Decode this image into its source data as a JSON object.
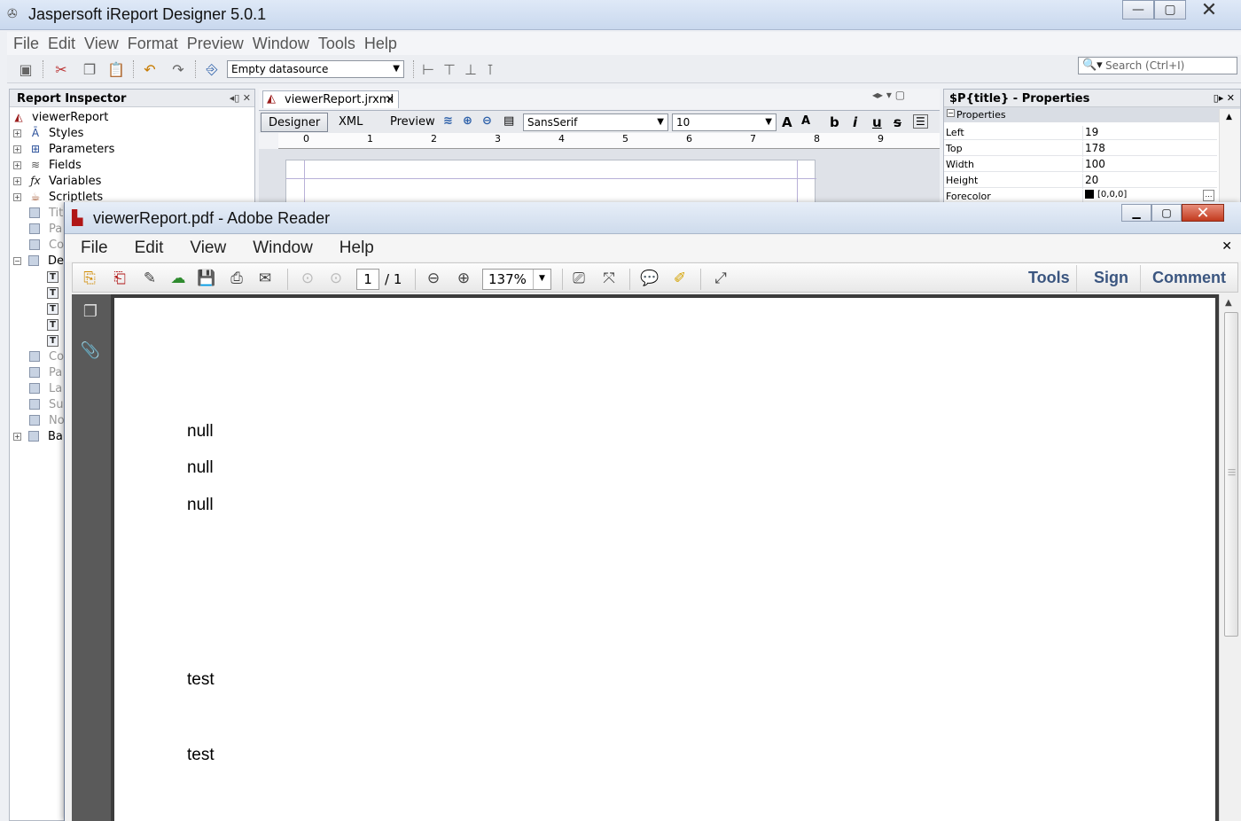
{
  "ireport": {
    "title": "Jaspersoft iReport Designer 5.0.1",
    "menu": [
      "File",
      "Edit",
      "View",
      "Format",
      "Preview",
      "Window",
      "Tools",
      "Help"
    ],
    "datasource": "Empty datasource",
    "search_placeholder": "Search (Ctrl+I)",
    "inspector": {
      "title": "Report Inspector",
      "root": "viewerReport",
      "items": [
        "Styles",
        "Parameters",
        "Fields",
        "Variables",
        "Scriptlets"
      ],
      "dim_items": [
        "Tit",
        "Pa",
        "Co",
        "De",
        "Co",
        "Pa",
        "La",
        "Su",
        "No",
        "Ba"
      ]
    },
    "designer": {
      "tab": "viewerReport.jrxml",
      "modes": [
        "Designer",
        "XML",
        "Preview"
      ],
      "font": "SansSerif",
      "font_size": "10",
      "ruler": [
        "0",
        "1",
        "2",
        "3",
        "4",
        "5",
        "6",
        "7",
        "8",
        "9"
      ]
    },
    "properties": {
      "title": "$P{title} - Properties",
      "category": "Properties",
      "rows": [
        {
          "key": "Left",
          "value": "19"
        },
        {
          "key": "Top",
          "value": "178"
        },
        {
          "key": "Width",
          "value": "100"
        },
        {
          "key": "Height",
          "value": "20"
        },
        {
          "key": "Forecolor",
          "value": "[0,0,0]"
        }
      ]
    }
  },
  "reader": {
    "title": "viewerReport.pdf - Adobe Reader",
    "menu": [
      "File",
      "Edit",
      "View",
      "Window",
      "Help"
    ],
    "page_current": "1",
    "page_total": "/ 1",
    "zoom": "137%",
    "links": [
      "Tools",
      "Sign",
      "Comment"
    ],
    "page_lines": [
      "null",
      "null",
      "null",
      "test",
      "test"
    ]
  },
  "colors": {
    "reader_link": "#3b5680",
    "reader_close": "#c23a1e",
    "nav_pane": "#5a5a5a"
  }
}
